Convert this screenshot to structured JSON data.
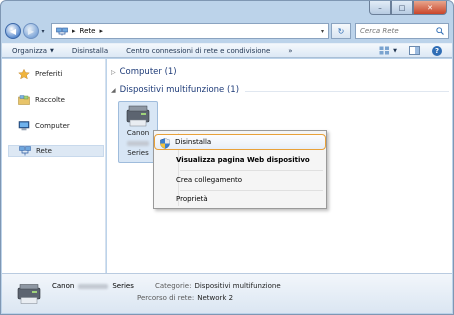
{
  "window": {
    "caption": {
      "minimize": "–",
      "maximize": "□",
      "close": "✕"
    }
  },
  "address": {
    "back": "◀",
    "forward": "▶",
    "breadcrumb_sep1": "▸",
    "location": "Rete",
    "breadcrumb_sep2": "▸",
    "drop": "▾",
    "refresh": "↻",
    "search_placeholder": "Cerca Rete"
  },
  "toolbar": {
    "organize": "Organizza",
    "organize_chev": "▼",
    "uninstall": "Disinstalla",
    "network_center": "Centro connessioni di rete e condivisione",
    "more": "»",
    "view_chev": "▼",
    "help": "?"
  },
  "nav": {
    "favorites": "Preferiti",
    "libraries": "Raccolte",
    "computer": "Computer",
    "network": "Rete"
  },
  "content": {
    "group_computer": "Computer (1)",
    "group_devices": "Dispositivi multifunzione (1)",
    "device_line1": "Canon",
    "device_line3": "Series"
  },
  "context_menu": {
    "uninstall": "Disinstalla",
    "view_web": "Visualizza pagina Web dispositivo",
    "create_shortcut": "Crea collegamento",
    "properties": "Proprietà"
  },
  "details": {
    "name_prefix": "Canon",
    "name_suffix": "Series",
    "category_label": "Categorie:",
    "category_value": "Dispositivi multifunzione",
    "path_label": "Percorso di rete:",
    "path_value": "Network 2"
  },
  "colors": {
    "window_frame": "#bcd3ea",
    "accent_highlight": "#e8a13a",
    "link_blue": "#1e3b78",
    "close_red": "#c9452a"
  },
  "icons": {
    "back": "back-arrow-icon",
    "forward": "forward-arrow-icon",
    "refresh": "refresh-icon",
    "search": "search-icon",
    "favorites": "star-icon",
    "libraries": "libraries-icon",
    "computer": "computer-icon",
    "network": "network-icon",
    "device": "multifunction-printer-icon",
    "shield": "uac-shield-icon"
  }
}
